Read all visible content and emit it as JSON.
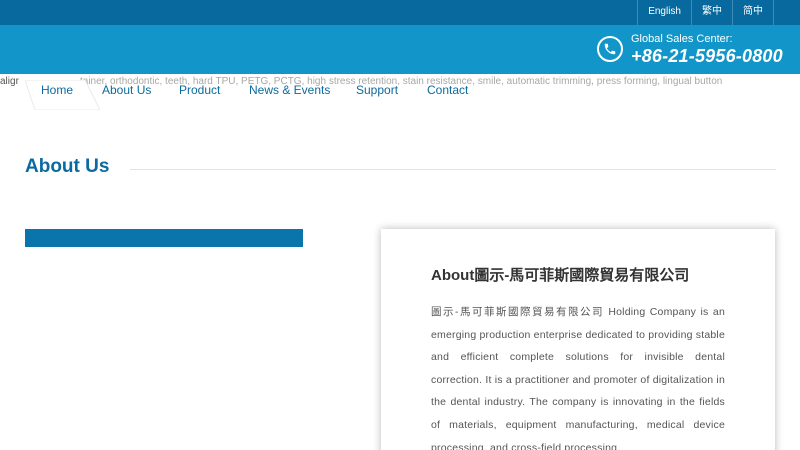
{
  "topbar": {
    "languages": [
      "English",
      "繁中",
      "简中"
    ]
  },
  "header": {
    "sales_label": "Global Sales Center:",
    "sales_phone": "+86-21-5956-0800",
    "phone_icon": "phone-icon"
  },
  "keywords": {
    "prefix": "aligr",
    "text": "tainer, orthodontic, teeth, hard TPU, PETG, PCTG, high stress retention, stain resistance, smile, automatic trimming, press forming, lingual button"
  },
  "nav": {
    "items": [
      "Home",
      "About Us",
      "Product",
      "News & Events",
      "Support",
      "Contact"
    ]
  },
  "section": {
    "title": "About Us"
  },
  "card": {
    "title": "About圖示-馬可菲斯國際貿易有限公司",
    "body": "圖示-馬可菲斯國際貿易有限公司 Holding Company is an emerging production enterprise dedicated to providing stable and efficient complete solutions for invisible dental correction. It is a practitioner and promoter of digitalization in the dental industry. The company is innovating in the fields of materials, equipment manufacturing, medical device processing, and cross-field processing."
  },
  "colors": {
    "topbar": "#07699e",
    "header": "#1296c9",
    "accent": "#0b6a9f",
    "bar": "#0a75ab"
  }
}
